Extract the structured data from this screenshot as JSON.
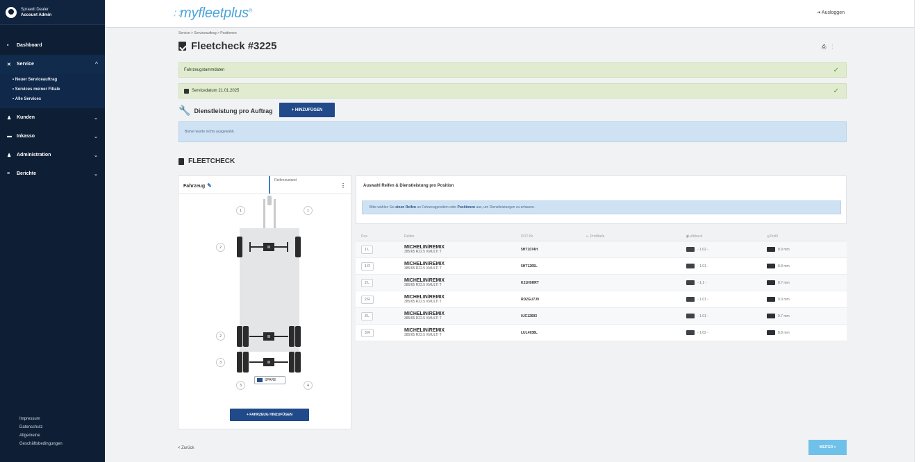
{
  "user": {
    "line1": "Spraedi Dealer",
    "line2": "Account Admin"
  },
  "sidebar": {
    "items": [
      {
        "label": "Dashboard",
        "icon": "grid-icon"
      },
      {
        "label": "Service",
        "icon": "wrench-icon"
      },
      {
        "label": "Kunden",
        "icon": "person-icon"
      },
      {
        "label": "Inkasso",
        "icon": "truck-icon"
      },
      {
        "label": "Administration",
        "icon": "group-icon"
      },
      {
        "label": "Berichte",
        "icon": "chart-icon"
      }
    ],
    "sub_items": [
      "Neuer Serviceauftrag",
      "Services meiner Filiale",
      "Alle Services"
    ],
    "footer_links": [
      "Impressum",
      "Datenschutz",
      "Allgemeine",
      "Geschäftsbedingungen"
    ]
  },
  "topbar": {
    "logo": "myfleetplus",
    "logout_label": "Ausloggen"
  },
  "breadcrumb": "Service  >  Serviceauftrag  >  Positionen",
  "page": {
    "title": "Fleetcheck #3225"
  },
  "alerts": {
    "bar1": "Fahrzeugstammdaten",
    "bar2": "Servicedatum 21.01.2025"
  },
  "service_section": {
    "title": "Dienstleistung pro Auftrag",
    "add_button": "+ HINZUFÜGEN",
    "info_text": "Bisher wurde nichts ausgewählt."
  },
  "fleetcheck": {
    "title": "FLEETCHECK",
    "tab_vehicle": "Fahrzeug",
    "tab_other": "Reifenzustand",
    "spare_label": "SPARE",
    "add_vehicle_button": "+ FAHRZEUG HINZUFÜGEN",
    "positions": [
      "1",
      "1",
      "2",
      "2",
      "3",
      "3",
      "4",
      "4"
    ]
  },
  "tire_panel": {
    "title": "Auswahl Reifen & Dienstleistung pro Position",
    "info_pre": "Bitte wählen Sie ",
    "info_link1": "einen Reifen",
    "info_mid": " an Fahrzeugposition oder ",
    "info_link2": "Positionen",
    "info_post": " aus, um Dienstleistungen zu erfassen."
  },
  "table": {
    "headers": [
      "Pos.",
      "Reifen",
      "DOT-Nr.",
      "Profiltiefe",
      "Luftdruck",
      "Profil"
    ],
    "rows": [
      {
        "pos": "1 L",
        "brand": "MICHELIN/REMIX",
        "dim": "385/65 R22.5 XMULTI T",
        "dot": "5HT1074H",
        "pressure": "1.02",
        "profile": "8.9 mm"
      },
      {
        "pos": "1 R",
        "brand": "MICHELIN/REMIX",
        "dim": "385/65 R22.5 XMULTI T",
        "dot": "5HT1265L",
        "pressure": "1.01",
        "profile": "8.8 mm"
      },
      {
        "pos": "2 L",
        "brand": "MICHELIN/REMIX",
        "dim": "385/65 R22.5 XMULTI T",
        "dot": "KJ1H9HRT",
        "pressure": "1.1",
        "profile": "8.7 mm"
      },
      {
        "pos": "2 R",
        "brand": "MICHELIN/REMIX",
        "dim": "385/65 R22.5 XMULTI T",
        "dot": "RD2GU7J9",
        "pressure": "1.01",
        "profile": "9.0 mm"
      },
      {
        "pos": "3 L",
        "brand": "MICHELIN/REMIX",
        "dim": "385/65 R22.5 XMULTI T",
        "dot": "0JC12693",
        "pressure": "1.01",
        "profile": "9.7 mm"
      },
      {
        "pos": "3 R",
        "brand": "MICHELIN/REMIX",
        "dim": "385/65 R22.5 XMULTI T",
        "dot": "LUL4938L",
        "pressure": "1.02",
        "profile": "8.8 mm"
      }
    ]
  },
  "footer": {
    "back_label": "< Zurück",
    "next_label": "WEITER >"
  }
}
